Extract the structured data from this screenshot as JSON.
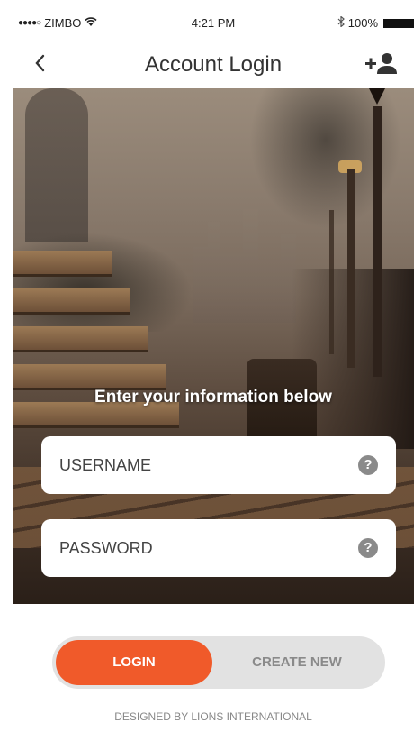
{
  "status_bar": {
    "carrier": "ZIMBO",
    "signal_dots": "●●●●○",
    "time": "4:21 PM",
    "battery": "100%",
    "icons": [
      "wifi-icon",
      "bluetooth-icon",
      "battery-icon"
    ]
  },
  "nav": {
    "back_glyph": "<",
    "title": "Account Login",
    "add_user_icon": "add-user-icon"
  },
  "hero": {
    "headline": "Enter your information below"
  },
  "form": {
    "username_placeholder": "USERNAME",
    "password_placeholder": "PASSWORD",
    "help_glyph": "?"
  },
  "actions": {
    "login_label": "LOGIN",
    "create_label": "CREATE NEW"
  },
  "footer": {
    "text": "DESIGNED BY LIONS INTERNATIONAL"
  },
  "colors": {
    "accent": "#f05a2a",
    "segment_bg": "#e2e2e2",
    "help_icon": "#8a8a8a"
  }
}
